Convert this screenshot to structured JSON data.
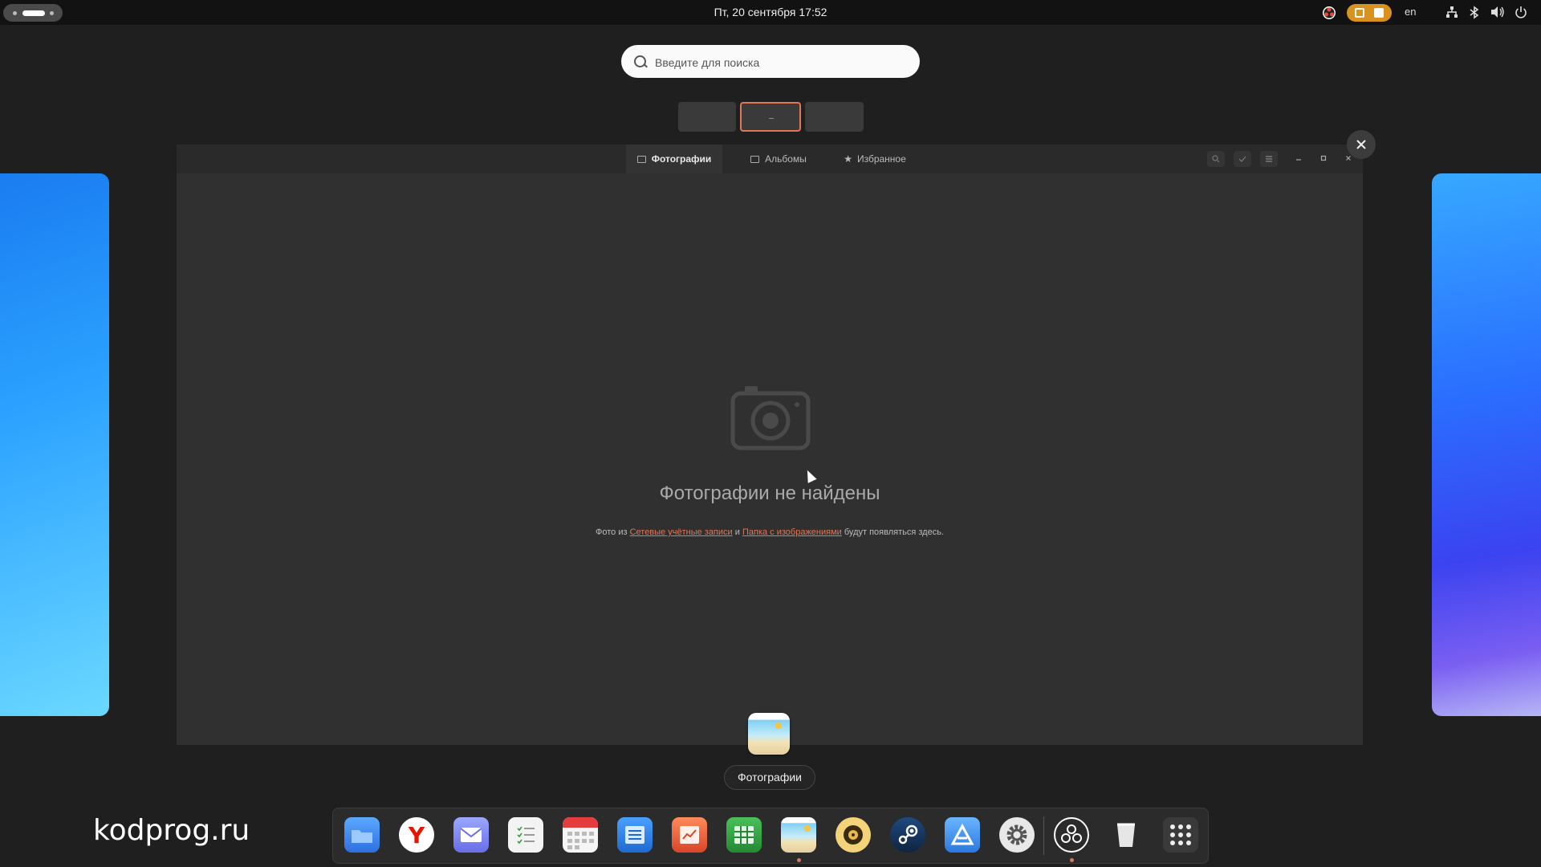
{
  "topbar": {
    "clock": "Пт, 20 сентября  17:52",
    "keyboard_layout": "en"
  },
  "search": {
    "placeholder": "Введите для поиска"
  },
  "window": {
    "tabs": [
      {
        "label": "Фотографии",
        "active": true
      },
      {
        "label": "Альбомы",
        "active": false
      },
      {
        "label": "Избранное",
        "active": false
      }
    ],
    "empty_state": {
      "title": "Фотографии не найдены",
      "desc_prefix": "Фото из",
      "link_accounts": "Сетевые учётные записи",
      "desc_and": "и",
      "link_folder": "Папка с изображениями",
      "desc_suffix": "будут появляться здесь."
    }
  },
  "app_label": "Фотографии",
  "watermark": "kodprog.ru",
  "dock": {
    "items": [
      {
        "name": "files",
        "color": "#3f8ef5"
      },
      {
        "name": "yandex-browser",
        "color": "#ffffff"
      },
      {
        "name": "mail",
        "color": "#7f8cf0"
      },
      {
        "name": "tasks",
        "color": "#f0f0f0"
      },
      {
        "name": "calendar",
        "color": "#f4f4f4"
      },
      {
        "name": "text-editor",
        "color": "#2f7fd8"
      },
      {
        "name": "presentation",
        "color": "#e2603c"
      },
      {
        "name": "spreadsheet",
        "color": "#2f9e44"
      },
      {
        "name": "photos",
        "color": "#9fdcf7"
      },
      {
        "name": "rhythmbox",
        "color": "#e8b94a"
      },
      {
        "name": "steam",
        "color": "#1b3d6a"
      },
      {
        "name": "app-center",
        "color": "#3a8ef0"
      },
      {
        "name": "settings",
        "color": "#555555"
      },
      {
        "name": "obs-studio",
        "color": "#2a2a2a"
      },
      {
        "name": "trash",
        "color": "#dddddd"
      },
      {
        "name": "show-apps",
        "color": "#3a3a3a"
      }
    ]
  },
  "accent_color": "#e0775a"
}
